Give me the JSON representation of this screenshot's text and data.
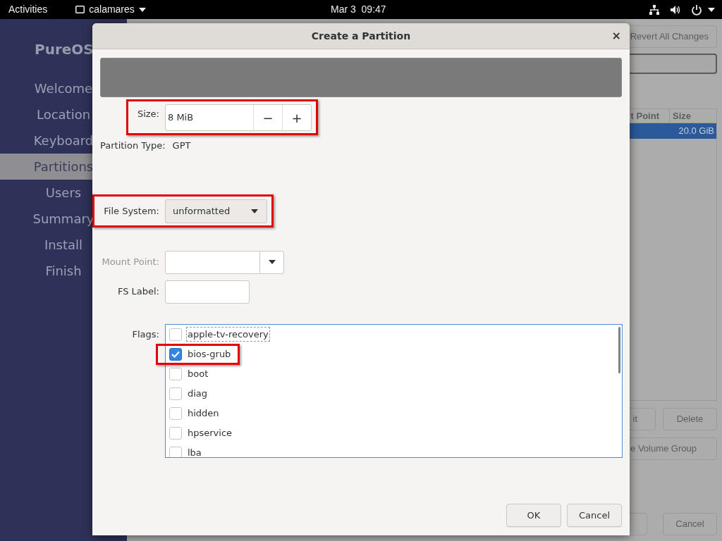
{
  "top_bar": {
    "activities": "Activities",
    "app_menu": "calamares",
    "clock": "Mar 3  09:47"
  },
  "sidebar": {
    "title": "PureOS",
    "items": [
      {
        "label": "Welcome",
        "selected": false
      },
      {
        "label": "Location",
        "selected": false
      },
      {
        "label": "Keyboard",
        "selected": false
      },
      {
        "label": "Partitions",
        "selected": true
      },
      {
        "label": "Users",
        "selected": false
      },
      {
        "label": "Summary",
        "selected": false
      },
      {
        "label": "Install",
        "selected": false
      },
      {
        "label": "Finish",
        "selected": false
      }
    ]
  },
  "main": {
    "revert_button": "Revert All Changes",
    "table": {
      "columns": [
        "t Point",
        "Size"
      ],
      "rows": [
        {
          "size": "20.0 GiB",
          "selected": true
        }
      ]
    },
    "edit_button": "it",
    "delete_button": "Delete",
    "volume_group_button": "e Volume Group",
    "cancel_button": "Cancel"
  },
  "dialog": {
    "title": "Create a Partition",
    "close": "×",
    "size": {
      "label": "Size:",
      "value": "8 MiB",
      "minus": "−",
      "plus": "+",
      "highlighted": true
    },
    "partition_type": {
      "label": "Partition Type:",
      "value": "GPT"
    },
    "file_system": {
      "label": "File System:",
      "value": "unformatted",
      "highlighted": true
    },
    "mount_point": {
      "label": "Mount Point:",
      "disabled": true
    },
    "fs_label": {
      "label": "FS Label:"
    },
    "flags": {
      "label": "Flags:",
      "items": [
        {
          "label": "apple-tv-recovery",
          "checked": false,
          "focused": true,
          "highlighted": false
        },
        {
          "label": "bios-grub",
          "checked": true,
          "focused": false,
          "highlighted": true
        },
        {
          "label": "boot",
          "checked": false,
          "focused": false,
          "highlighted": false
        },
        {
          "label": "diag",
          "checked": false,
          "focused": false,
          "highlighted": false
        },
        {
          "label": "hidden",
          "checked": false,
          "focused": false,
          "highlighted": false
        },
        {
          "label": "hpservice",
          "checked": false,
          "focused": false,
          "highlighted": false
        },
        {
          "label": "lba",
          "checked": false,
          "focused": false,
          "highlighted": false
        }
      ]
    },
    "buttons": [
      "OK",
      "Cancel"
    ]
  }
}
